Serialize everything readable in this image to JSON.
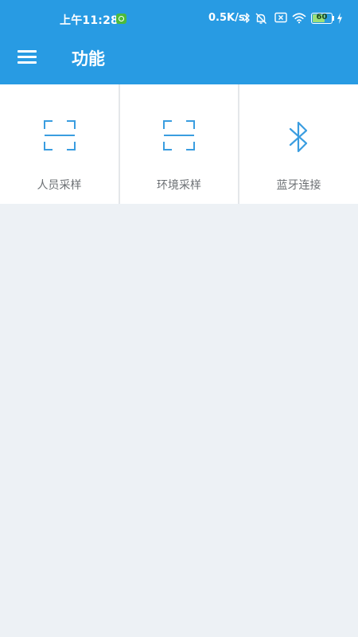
{
  "status_bar": {
    "time": "上午11:28",
    "net_speed": "0.5K/s",
    "battery_level": "60",
    "icons": [
      "notification-app-icon",
      "bluetooth-icon",
      "alarm-off-icon",
      "sim-off-icon",
      "wifi-icon",
      "battery-icon",
      "charging-icon"
    ]
  },
  "app_bar": {
    "title": "功能",
    "menu_icon": "hamburger-menu-icon",
    "color": "#289be3"
  },
  "functions": [
    {
      "label": "人员采样",
      "icon": "scan-icon"
    },
    {
      "label": "环境采样",
      "icon": "scan-icon"
    },
    {
      "label": "蓝牙连接",
      "icon": "bluetooth-icon"
    }
  ],
  "colors": {
    "primary": "#289be3",
    "icon_blue": "#3a9de0",
    "background": "#edf1f5",
    "label_gray": "#6b6f73"
  }
}
